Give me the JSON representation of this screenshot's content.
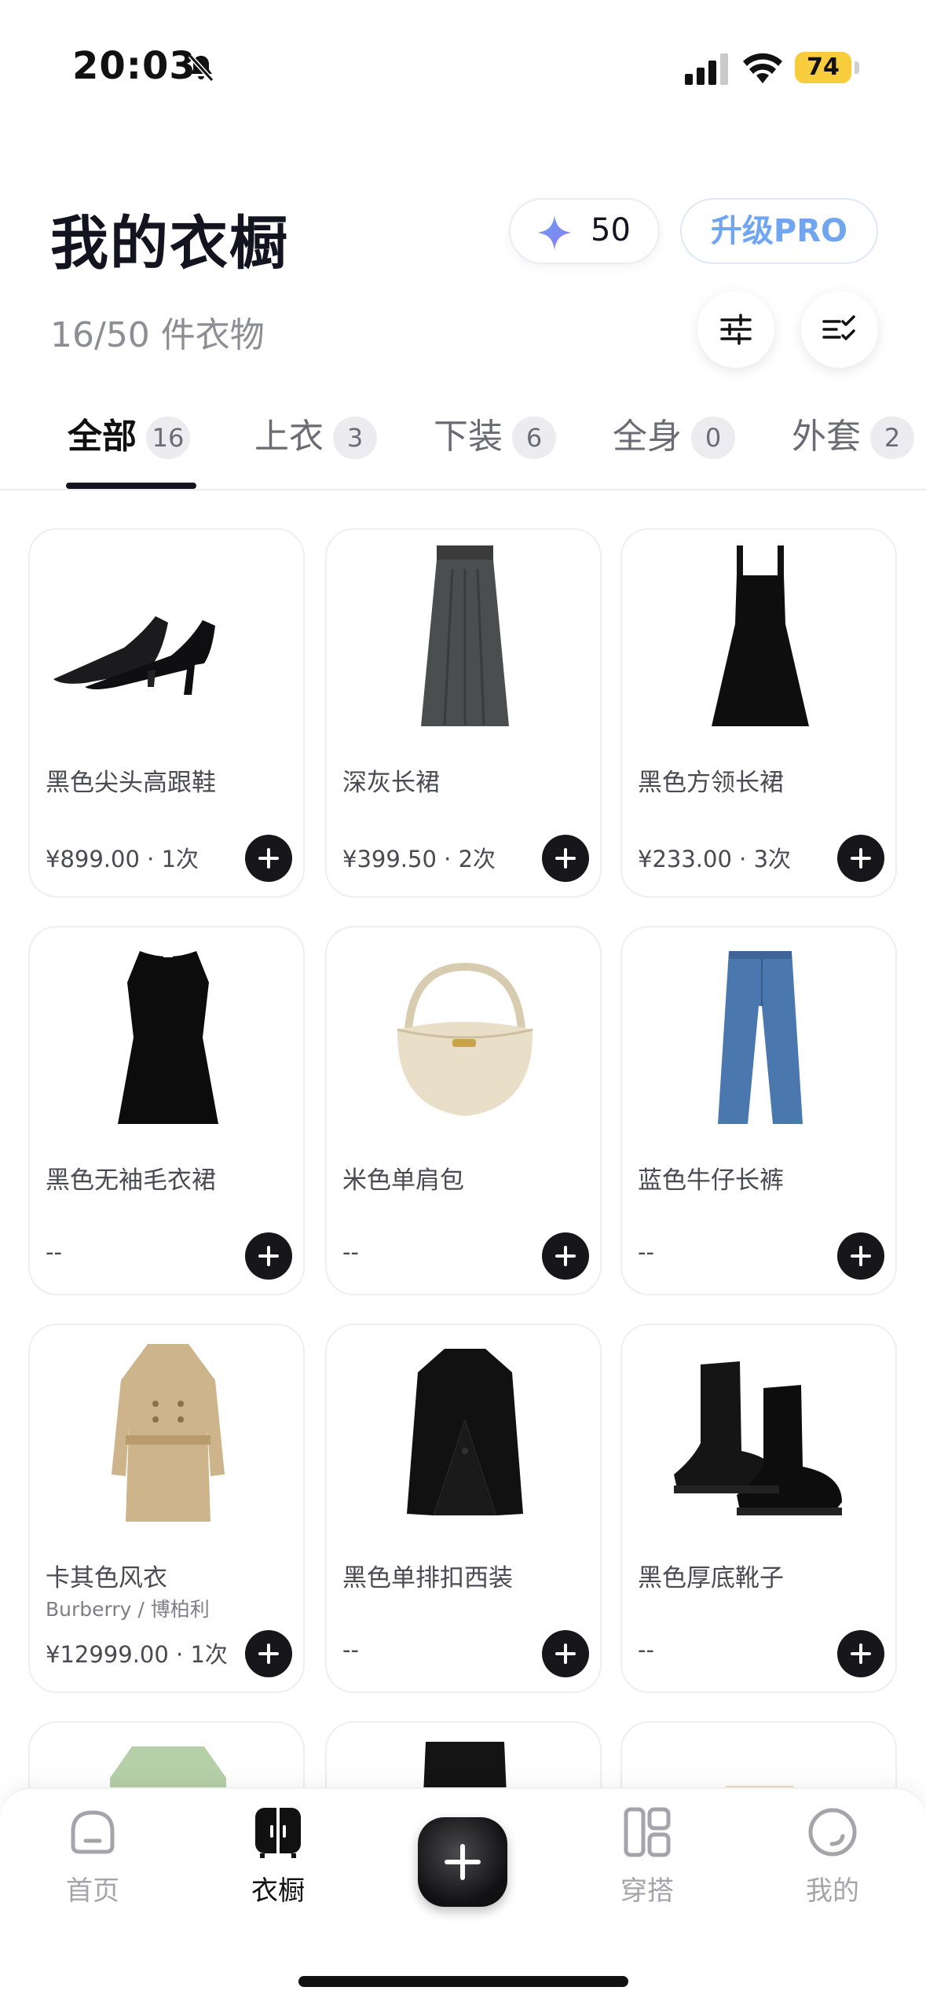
{
  "status_bar": {
    "time": "20:03",
    "battery": "74"
  },
  "header": {
    "title": "我的衣橱",
    "subtitle": "16/50 件衣物",
    "credits": "50",
    "upgrade_label": "升级PRO"
  },
  "tabs": [
    {
      "label": "全部",
      "count": "16"
    },
    {
      "label": "上衣",
      "count": "3"
    },
    {
      "label": "下装",
      "count": "6"
    },
    {
      "label": "全身",
      "count": "0"
    },
    {
      "label": "外套",
      "count": "2"
    }
  ],
  "items": [
    {
      "name": "黑色尖头高跟鞋",
      "brand": "",
      "meta": "¥899.00 · 1次",
      "icon": "black-heels-image"
    },
    {
      "name": "深灰长裙",
      "brand": "",
      "meta": "¥399.50 · 2次",
      "icon": "dark-gray-skirt-image"
    },
    {
      "name": "黑色方领长裙",
      "brand": "",
      "meta": "¥233.00 · 3次",
      "icon": "black-square-neck-dress-image"
    },
    {
      "name": "黑色无袖毛衣裙",
      "brand": "",
      "meta": "--",
      "icon": "black-sleeveless-knit-dress-image"
    },
    {
      "name": "米色单肩包",
      "brand": "",
      "meta": "--",
      "icon": "beige-shoulder-bag-image"
    },
    {
      "name": "蓝色牛仔长裤",
      "brand": "",
      "meta": "--",
      "icon": "blue-jeans-image"
    },
    {
      "name": "卡其色风衣",
      "brand": "Burberry / 博柏利",
      "meta": "¥12999.00 · 1次",
      "icon": "khaki-trench-coat-image"
    },
    {
      "name": "黑色单排扣西装",
      "brand": "",
      "meta": "--",
      "icon": "black-blazer-image"
    },
    {
      "name": "黑色厚底靴子",
      "brand": "",
      "meta": "--",
      "icon": "black-chelsea-boots-image"
    },
    {
      "name": "",
      "brand": "",
      "meta": "",
      "icon": "green-shirt-image"
    },
    {
      "name": "",
      "brand": "",
      "meta": "",
      "icon": "black-satin-skirt-image"
    },
    {
      "name": "",
      "brand": "",
      "meta": "",
      "icon": "beige-item-image"
    }
  ],
  "nav": [
    {
      "label": "首页",
      "icon": "home-icon"
    },
    {
      "label": "衣橱",
      "icon": "wardrobe-icon"
    },
    {
      "label": "穿搭",
      "icon": "outfit-icon"
    },
    {
      "label": "我的",
      "icon": "profile-icon"
    }
  ],
  "colors": {
    "accent_blue": "#6fa6ef",
    "battery": "#f7cd3d",
    "dark": "#141420"
  }
}
